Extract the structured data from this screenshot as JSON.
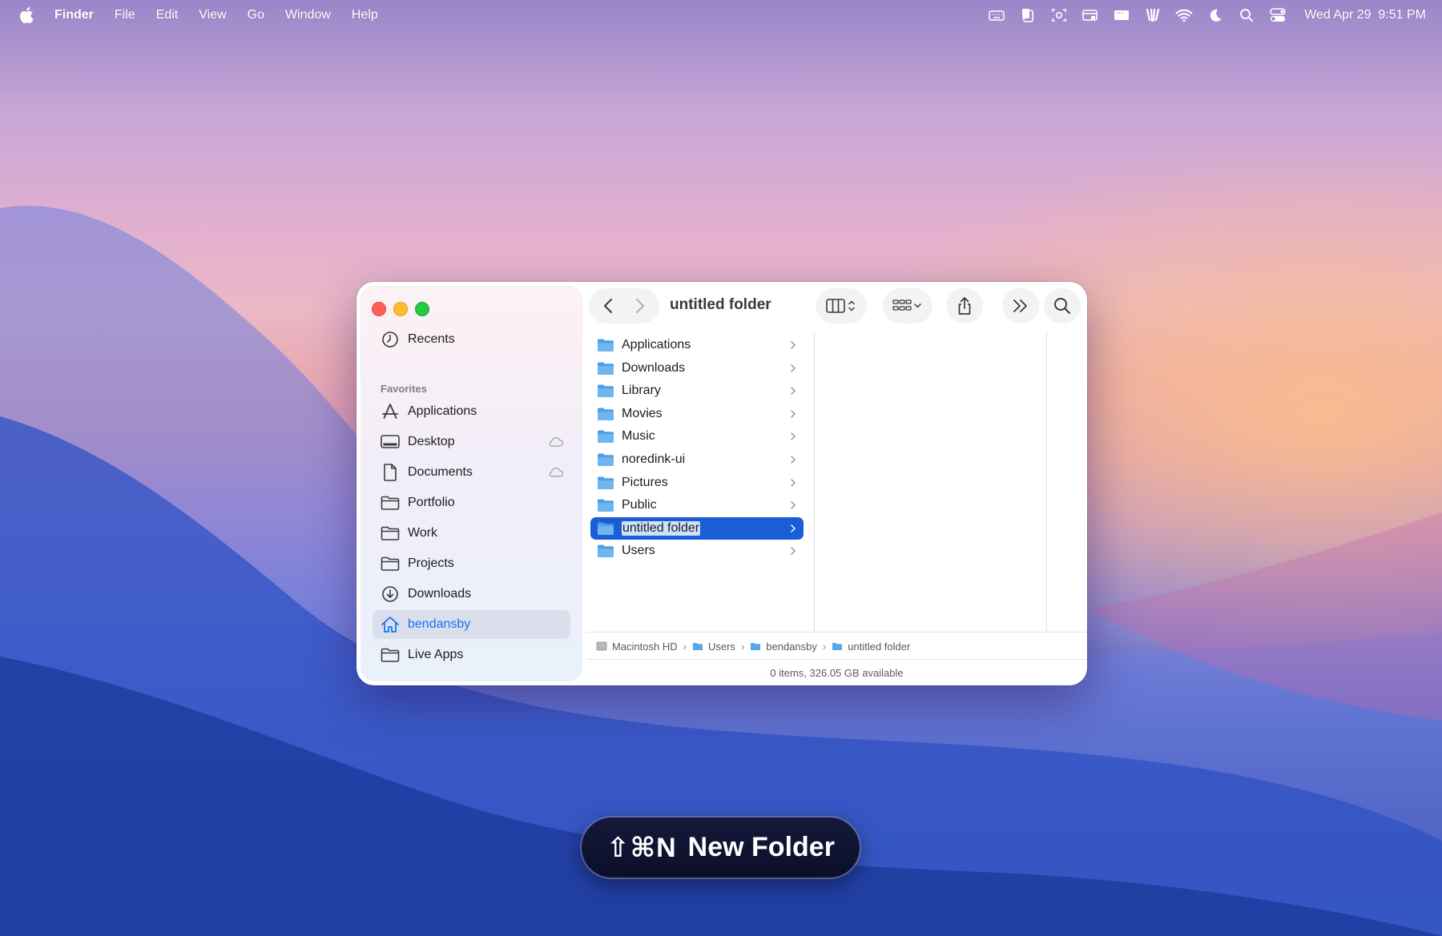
{
  "menubar": {
    "app_name": "Finder",
    "items": [
      "File",
      "Edit",
      "View",
      "Go",
      "Window",
      "Help"
    ],
    "status_icons": [
      "keyboard-icon",
      "clipboard-icon",
      "screenshot-icon",
      "display-icon",
      "window-icon",
      "accessibility-icon",
      "wifi-icon",
      "moon-icon",
      "spotlight-icon",
      "control-center-icon"
    ],
    "date": "Wed Apr 29",
    "time": "9:51 PM"
  },
  "window": {
    "title": "untitled folder",
    "sidebar": {
      "recents_label": "Recents",
      "favorites_heading": "Favorites",
      "items": [
        {
          "label": "Applications",
          "icon": "apps-icon"
        },
        {
          "label": "Desktop",
          "icon": "desktop-icon",
          "cloud": true
        },
        {
          "label": "Documents",
          "icon": "document-icon",
          "cloud": true
        },
        {
          "label": "Portfolio",
          "icon": "folder-icon"
        },
        {
          "label": "Work",
          "icon": "folder-icon"
        },
        {
          "label": "Projects",
          "icon": "folder-icon"
        },
        {
          "label": "Downloads",
          "icon": "download-icon"
        },
        {
          "label": "bendansby",
          "icon": "home-icon",
          "selected": true
        },
        {
          "label": "Live Apps",
          "icon": "folder-icon"
        }
      ]
    },
    "column": {
      "items": [
        "Applications",
        "Downloads",
        "Library",
        "Movies",
        "Music",
        "noredink-ui",
        "Pictures",
        "Public",
        "untitled folder",
        "Users"
      ],
      "selected": "untitled folder"
    },
    "path": [
      "Macintosh HD",
      "Users",
      "bendansby",
      "untitled folder"
    ],
    "status": "0 items, 326.05 GB available"
  },
  "hud": {
    "keys": "⇧⌘N",
    "action": "New Folder"
  },
  "colors": {
    "accent": "#1a5dd6",
    "sidebar_selected_text": "#1474f2",
    "folder": "#5aa7e8"
  }
}
